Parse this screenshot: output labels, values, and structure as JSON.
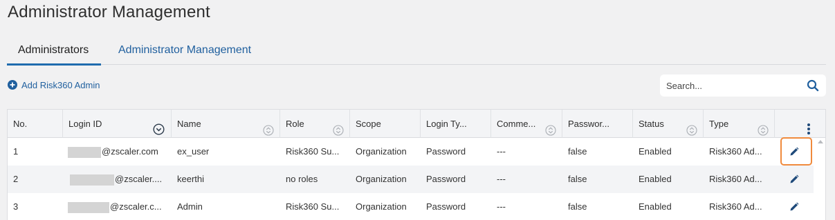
{
  "page": {
    "title": "Administrator Management"
  },
  "tabs": [
    {
      "label": "Administrators",
      "active": true
    },
    {
      "label": "Administrator Management",
      "active": false
    }
  ],
  "toolbar": {
    "add_label": "Add Risk360 Admin"
  },
  "search": {
    "placeholder": "Search..."
  },
  "table": {
    "columns": [
      "No.",
      "Login ID",
      "Name",
      "Role",
      "Scope",
      "Login Ty...",
      "Comme...",
      "Passwor...",
      "Status",
      "Type"
    ],
    "rows": [
      {
        "no": "1",
        "login_id": "@zscaler.com",
        "name": "ex_user",
        "role": "Risk360 Su...",
        "scope": "Organization",
        "login_type": "Password",
        "comments": "---",
        "password": "false",
        "status": "Enabled",
        "type": "Risk360 Ad..."
      },
      {
        "no": "2",
        "login_id": "@zscaler....",
        "name": "keerthi",
        "role": "no roles",
        "scope": "Organization",
        "login_type": "Password",
        "comments": "---",
        "password": "false",
        "status": "Enabled",
        "type": "Risk360 Ad..."
      },
      {
        "no": "3",
        "login_id": "@zscaler.c...",
        "name": "Admin",
        "role": "Risk360 Su...",
        "scope": "Organization",
        "login_type": "Password",
        "comments": "---",
        "password": "false",
        "status": "Enabled",
        "type": "Risk360 Ad..."
      }
    ]
  },
  "colors": {
    "accent": "#1f5f9e",
    "highlight": "#f08a3c"
  },
  "icons": {
    "add": "plus-circle-icon",
    "search": "search-icon",
    "sort": "sort-icon",
    "sort_active": "chevron-down-circle-icon",
    "edit": "pencil-icon",
    "more": "kebab-menu-icon"
  }
}
